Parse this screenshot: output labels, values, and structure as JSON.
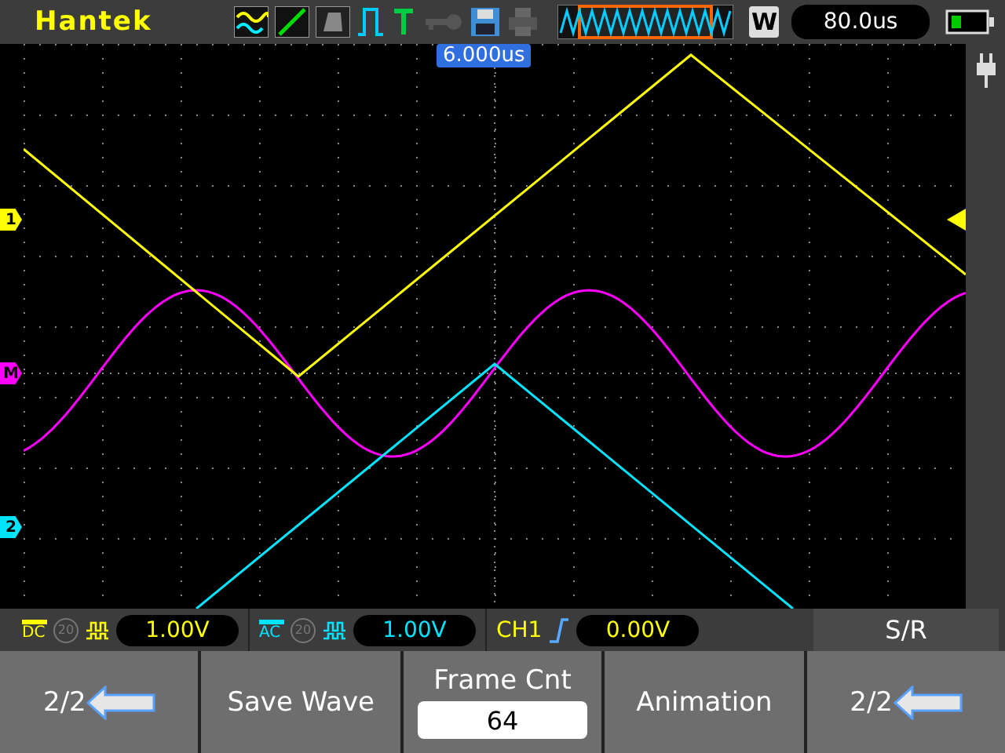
{
  "brand": "Hantek",
  "zoom_label": "W",
  "timebase": "80.0us",
  "trigger_position": "6.000us",
  "markers": [
    {
      "label": "1",
      "color": "#ffff00"
    },
    {
      "label": "M",
      "color": "#ff00ff"
    },
    {
      "label": "2",
      "color": "#00e5ff"
    }
  ],
  "channels": [
    {
      "coupling": "DC",
      "bw_limit": "20",
      "scale": "1.00V",
      "color": "#ffff00"
    },
    {
      "coupling": "AC",
      "bw_limit": "20",
      "scale": "1.00V",
      "color": "#00e5ff"
    }
  ],
  "trigger": {
    "source": "CH1",
    "level": "0.00V"
  },
  "menu_title": "S/R",
  "softkeys": [
    {
      "kind": "page",
      "label": "2/2"
    },
    {
      "kind": "plain",
      "label": "Save Wave"
    },
    {
      "kind": "value",
      "label": "Frame Cnt",
      "value": "64"
    },
    {
      "kind": "plain",
      "label": "Animation"
    },
    {
      "kind": "page",
      "label": "2/2"
    }
  ]
}
